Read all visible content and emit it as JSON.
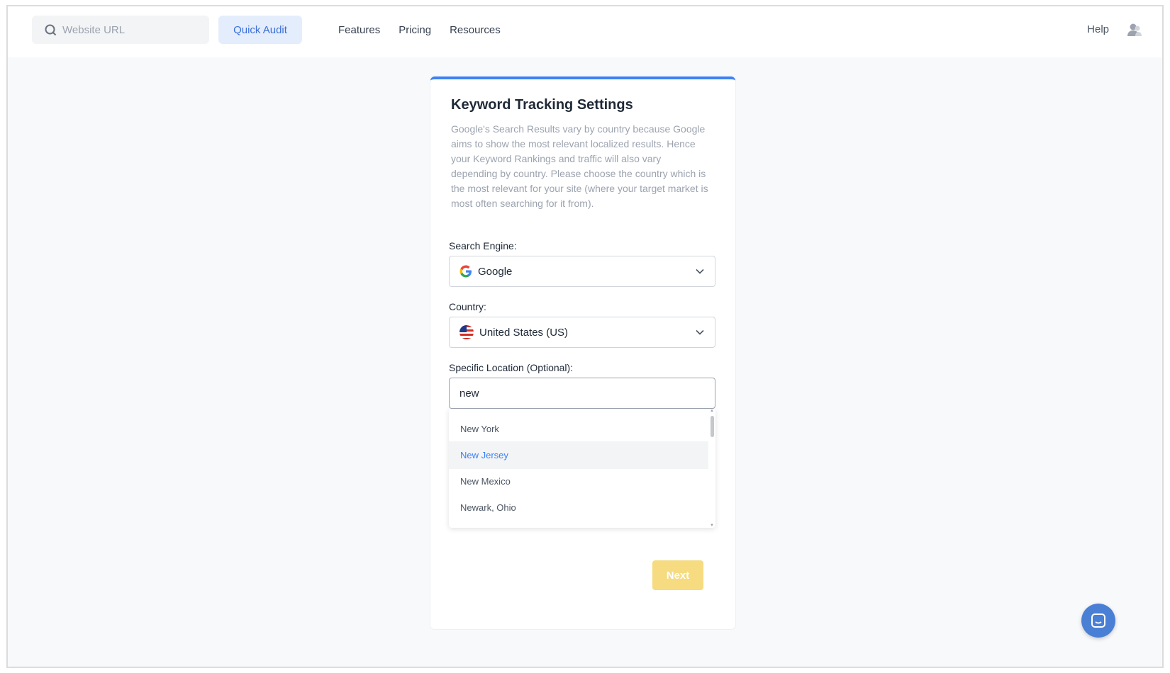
{
  "header": {
    "search_placeholder": "Website URL",
    "quick_audit_label": "Quick Audit",
    "nav": [
      "Features",
      "Pricing",
      "Resources"
    ],
    "help_label": "Help"
  },
  "card": {
    "title": "Keyword Tracking Settings",
    "description": "Google's Search Results vary by country because Google aims to show the most relevant localized results. Hence your Keyword Rankings and traffic will also vary depending by country. Please choose the country which is the most relevant for your site (where your target market is most often searching for it from).",
    "search_engine_label": "Search Engine:",
    "search_engine_value": "Google",
    "country_label": "Country:",
    "country_value": "United States (US)",
    "location_label": "Specific Location (Optional):",
    "location_value": "new",
    "suggestions": [
      "New York",
      "New Jersey",
      "New Mexico",
      "Newark, Ohio"
    ],
    "next_label": "Next"
  },
  "colors": {
    "accent": "#3b82f6",
    "next_button": "#f5d56b",
    "quick_audit_bg": "#e4edfc"
  }
}
